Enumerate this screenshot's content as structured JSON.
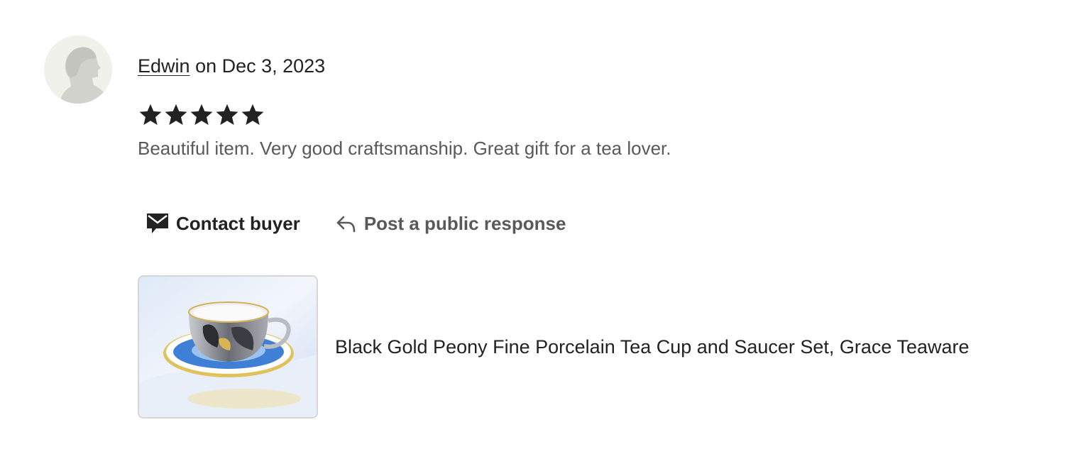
{
  "review": {
    "reviewer_name": "Edwin",
    "date_text": "on Dec 3, 2023",
    "rating": 5,
    "rating_max": 5,
    "text": "Beautiful item. Very good craftsmanship. Great gift for a tea lover."
  },
  "actions": {
    "contact_label": "Contact buyer",
    "respond_label": "Post a public response"
  },
  "listing": {
    "title": "Black Gold Peony Fine Porcelain Tea Cup and Saucer Set, Grace Teaware"
  },
  "icons": {
    "avatar": "person-silhouette-icon",
    "star": "star-icon",
    "contact": "envelope-icon",
    "respond": "reply-arrow-icon"
  },
  "colors": {
    "text_primary": "#222222",
    "text_secondary": "#595959",
    "star": "#222222"
  }
}
